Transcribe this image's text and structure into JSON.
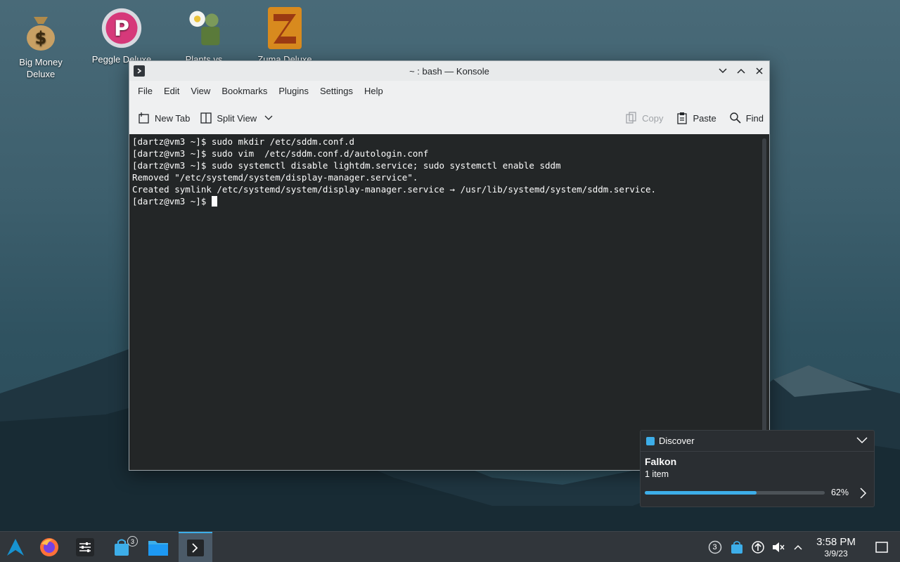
{
  "desktop": {
    "icons": [
      {
        "label": "Big Money Deluxe"
      },
      {
        "label": "Peggle Deluxe"
      },
      {
        "label": "Plants vs"
      },
      {
        "label": "Zuma Deluxe"
      }
    ]
  },
  "window": {
    "title": "~ : bash — Konsole",
    "menu": [
      "File",
      "Edit",
      "View",
      "Bookmarks",
      "Plugins",
      "Settings",
      "Help"
    ],
    "toolbar": {
      "new_tab": "New Tab",
      "split_view": "Split View",
      "copy": "Copy",
      "paste": "Paste",
      "find": "Find"
    },
    "terminal_lines": [
      "[dartz@vm3 ~]$ sudo mkdir /etc/sddm.conf.d",
      "[dartz@vm3 ~]$ sudo vim  /etc/sddm.conf.d/autologin.conf",
      "[dartz@vm3 ~]$ sudo systemctl disable lightdm.service; sudo systemctl enable sddm",
      "Removed \"/etc/systemd/system/display-manager.service\".",
      "Created symlink /etc/systemd/system/display-manager.service → /usr/lib/systemd/system/sddm.service.",
      "[dartz@vm3 ~]$ "
    ]
  },
  "notification": {
    "source": "Discover",
    "title": "Falkon",
    "subtitle": "1 item",
    "progress": 0.62,
    "progress_label": "62%"
  },
  "taskbar": {
    "updates_badge": "3",
    "tray_badge": "3",
    "time": "3:58 PM",
    "date": "3/9/23"
  },
  "colors": {
    "accent": "#3daee9",
    "terminal_bg": "#232627",
    "panel_bg": "#31363b"
  }
}
